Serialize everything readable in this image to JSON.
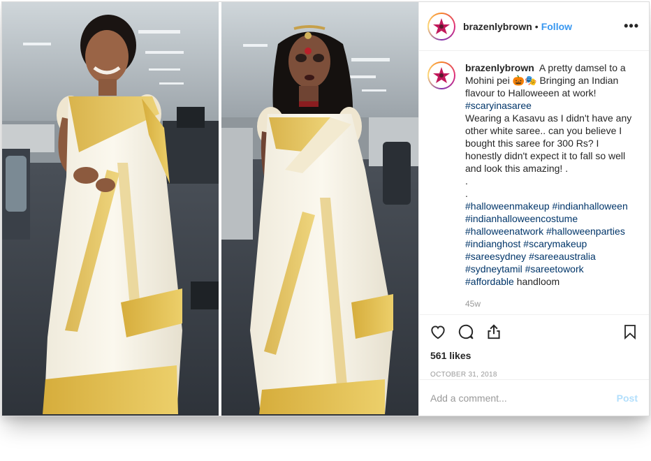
{
  "post": {
    "username": "brazenlybrown",
    "follow_label": "Follow",
    "separator": "•",
    "more_label": "•••",
    "caption": {
      "username": "brazenlybrown",
      "line1": "A pretty damsel to a Mohini pei 🎃🎭 Bringing an Indian flavour to Halloweeen at work!",
      "tag_top": "#scaryinasaree",
      "body": "Wearing a Kasavu as I didn't have any other white saree.. can you believe I bought this saree for 300 Rs? I honestly didn't expect it to fall so well and look this amazing! .",
      "dot1": ".",
      "dot2": ".",
      "hashtags": [
        "#halloweenmakeup",
        "#indianhalloween",
        "#indianhalloweencostume",
        "#halloweenatwork",
        "#halloweenparties",
        "#indianghost",
        "#scarymakeup",
        "#sareesydney",
        "#sareeaustralia",
        "#sydneytamil",
        "#sareetowork",
        "#affordable"
      ],
      "last_word": "handloom",
      "time_ago": "45w"
    },
    "icons": [
      "heart-icon",
      "comment-icon",
      "share-icon",
      "bookmark-icon"
    ],
    "likes": "561 likes",
    "date": "OCTOBER 31, 2018",
    "comment_placeholder": "Add a comment...",
    "post_label": "Post",
    "colors": {
      "follow": "#3897f0",
      "hashtag": "#003569",
      "post_disabled": "#b2dffc",
      "muted": "#999999"
    }
  }
}
